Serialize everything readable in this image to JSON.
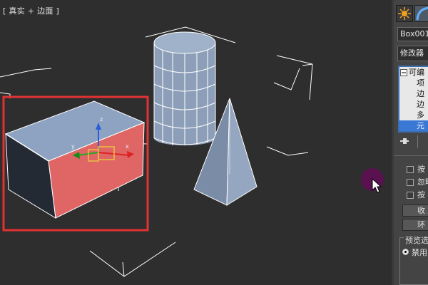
{
  "viewport": {
    "label": "[ 真实 + 边面 ]",
    "selection_color": "#e33232",
    "objects": [
      "box",
      "cylinder",
      "cone",
      "bounding-box-helpers"
    ]
  },
  "gizmo": {
    "axis_x": "x",
    "axis_y": "y",
    "axis_z": "z"
  },
  "command_panel": {
    "tabs": [
      {
        "icon": "create-sun-icon"
      },
      {
        "icon": "modify-arc-icon"
      }
    ],
    "object_name": "Box001",
    "modifier_list": "修改器",
    "stack": [
      {
        "label": "可编"
      },
      {
        "label": "项"
      },
      {
        "label": "边"
      },
      {
        "label": "边"
      },
      {
        "label": "多"
      },
      {
        "label": "元"
      }
    ],
    "options": {
      "check1": "按",
      "check2": "忽略",
      "check3": "按",
      "button1": "收",
      "button2": "环"
    },
    "preview_label": "预览选",
    "preview_option": "禁用"
  },
  "colors": {
    "viewport_bg": "#2e2e2e",
    "shape_face": "#8d9fb8",
    "selected_face": "#d96464",
    "wire": "#ffffff"
  }
}
